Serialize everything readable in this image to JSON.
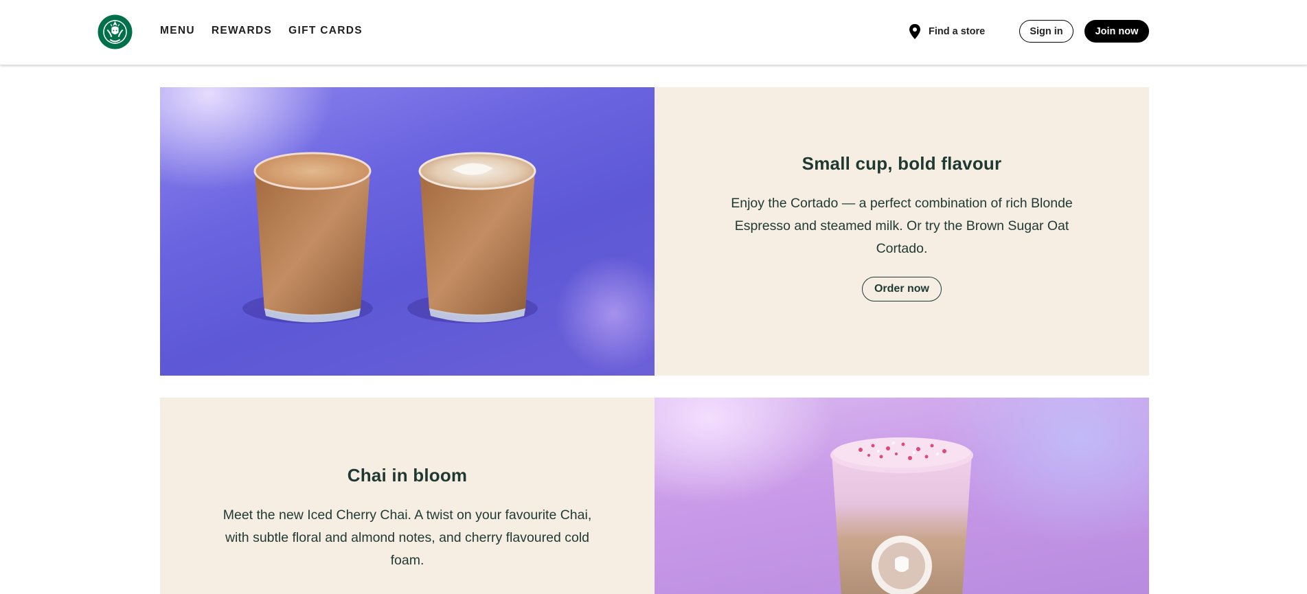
{
  "nav": {
    "items": [
      {
        "label": "MENU"
      },
      {
        "label": "REWARDS"
      },
      {
        "label": "GIFT CARDS"
      }
    ],
    "find_store": "Find a store",
    "sign_in": "Sign in",
    "join_now": "Join now"
  },
  "promos": [
    {
      "title": "Small cup, bold flavour",
      "body": "Enjoy the Cortado — a perfect combination of rich Blonde Espresso and steamed milk. Or try the Brown Sugar Oat Cortado.",
      "button": "Order now"
    },
    {
      "title": "Chai in bloom",
      "body": "Meet the new Iced Cherry Chai. A twist on your favourite Chai, with subtle floral and almond notes, and cherry flavoured cold foam."
    }
  ],
  "colors": {
    "brand_green": "#006241",
    "house_green": "#1e3932",
    "cream": "#f7eee3"
  }
}
